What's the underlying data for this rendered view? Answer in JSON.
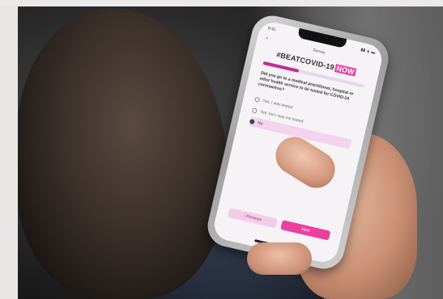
{
  "phone_screen": {
    "status_time": "9:41",
    "nav_title": "Survey",
    "close_glyph": "×",
    "brand_text": "#BEATCOVID-19",
    "brand_badge": "NOW",
    "progress_fraction": 0.35,
    "question": "Did you go to a medical practitioner, hospital or other health service to be tested for COVID-19 coronavirus?",
    "options": [
      {
        "label": "Yes, I was tested",
        "selected": false
      },
      {
        "label": "Yes, but I was not tested",
        "selected": false
      },
      {
        "label": "No",
        "selected": true
      }
    ],
    "previous_label": "‹ Previous",
    "next_label": "Next"
  },
  "colors": {
    "brand_pink": "#ec3fa0",
    "selected_bg": "#f4d3ee"
  },
  "icons": {
    "close": "close-icon"
  }
}
